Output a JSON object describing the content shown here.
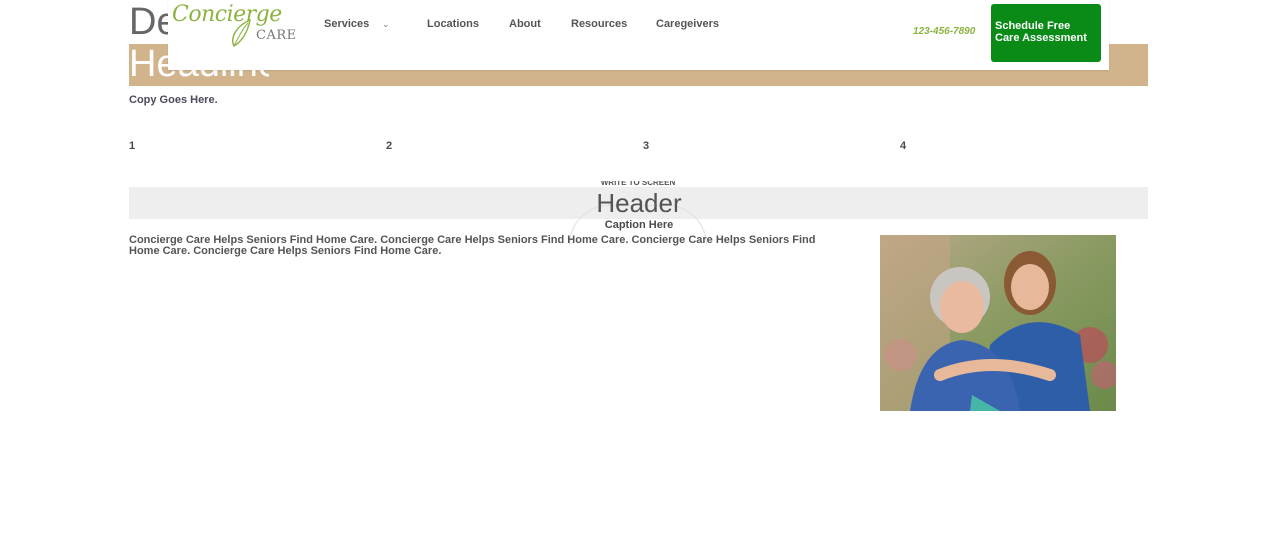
{
  "hero": {
    "title_fragment": "De",
    "headline_fragment": "Headline",
    "copy": "Copy Goes Here."
  },
  "nav": {
    "logo": {
      "script": "Concierge",
      "care": "CARE"
    },
    "items": [
      "Services",
      "Locations",
      "About",
      "Resources",
      "Caregeivers"
    ],
    "services_chevron": "⌄",
    "phone": "123-456-7890",
    "cta_label": "Schedule Free Care Assessment"
  },
  "numbers": [
    "1",
    "2",
    "3",
    "4"
  ],
  "section": {
    "overline": "WRITE TO SCREEN",
    "header": "Header",
    "caption": "Caption Here",
    "body": "Concierge Care Helps Seniors Find Home Care. Concierge Care Helps Seniors Find Home Care. Concierge Care Helps Seniors Find Home Care. Concierge Care Helps Seniors Find Home Care."
  },
  "colors": {
    "brand_green": "#8cb341",
    "cta_green": "#0a8a17",
    "hero_tan": "#d1b38c",
    "band_gray": "#eeeeee"
  }
}
